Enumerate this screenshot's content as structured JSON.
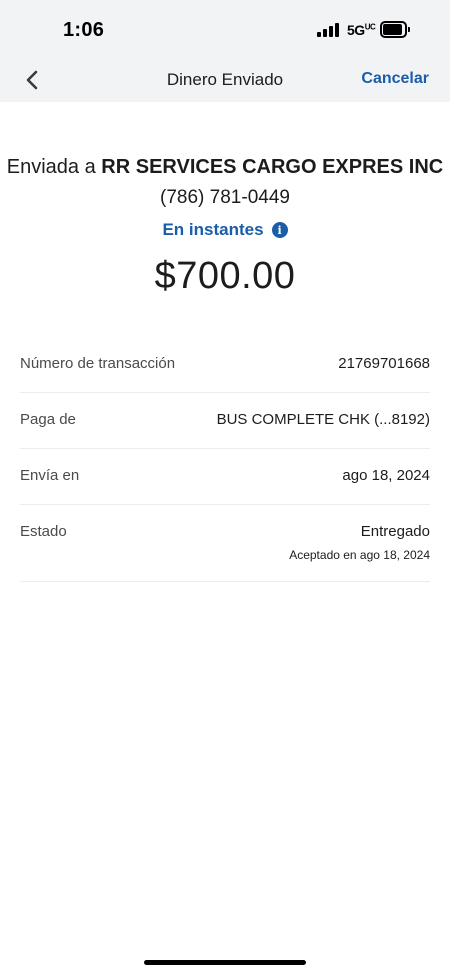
{
  "status_bar": {
    "time": "1:06",
    "network": "5G",
    "network_suffix": "UC"
  },
  "nav": {
    "title": "Dinero Enviado",
    "cancel_label": "Cancelar"
  },
  "transfer": {
    "prefix": "Enviada a ",
    "recipient": "RR SERVICES CARGO EXPRES INC",
    "phone": "(786) 781-0449",
    "speed": "En instantes",
    "amount": "$700.00"
  },
  "details": [
    {
      "label": "Número de transacción",
      "value": "21769701668"
    },
    {
      "label": "Paga de",
      "value": "BUS COMPLETE CHK (...8192)"
    },
    {
      "label": "Envía en",
      "value": "ago 18, 2024"
    },
    {
      "label": "Estado",
      "value": "Entregado",
      "sub": "Aceptado en ago 18, 2024"
    }
  ],
  "colors": {
    "accent": "#1a5ea8",
    "header_bg": "#f2f3f5"
  },
  "icons": {
    "back": "chevron-left-icon",
    "info": "info-icon"
  }
}
